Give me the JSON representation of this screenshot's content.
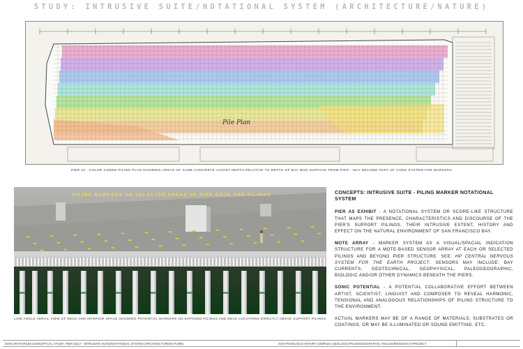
{
  "title": "STUDY: INTRUSIVE SUITE/NOTATIONAL SYSTEM (ARCHITECTURE/NATURE)",
  "plan": {
    "caption": "PIER 15 - COLOR CODED PILING PLAN SHOWING AREAS OF SAME CONCRETE JACKET DEPTH RELATIVE TO DEPTH OF BAY MUD SURFACE FROM PIER - MAY BECOME PART OF CODE SYSTEM FOR MARKERS",
    "label": "Pile Plan",
    "colors": [
      "#e9a0c8",
      "#c9a3e6",
      "#9fc2f0",
      "#9fe2d6",
      "#a8e08e",
      "#e6e487",
      "#f2c591"
    ]
  },
  "photo": {
    "callout": "PILING MARKERS ON SELECTED AREAS OF PIER DECK AND PILINGS",
    "caption": "LOW ANGLE AERIAL VIEW OF DECK AND INTERIOR SPACE SHOWING POTENTIAL MARKERS ON EXPOSED PILINGS AND DECK LOCATIONS DIRECTLY ABOVE SUPPORT PILINGS"
  },
  "concepts": {
    "heading": "CONCEPTS: INTRUSIVE SUITE - PILING MARKER NOTATIONAL SYSTEM",
    "exhibit_term": "PIER AS EXHIBIT",
    "exhibit_text": " - A NOTATIONAL SYSTEM OR SCORE-LIKE STRUCTURE THAT MAPS THE PRESENCE, CHARACTERISTICS AND DISCOURSE OF THE PIER'S SUPPORT PILINGS, THEIR INTRUSIVE EXTENT, HISTORY AND EFFECT ON THE NATURAL ENVIRONMENT OF SAN FRANCISCO BAY.",
    "mote_term": "MOTE ARRAY",
    "mote_text_1": " - MARKER SYSTEM AS A VISUAL/SPACIAL INDICATION STRUCTURE FOR A MOTE-BASED SENSOR ARRAY AT EACH OR SELECTED PILINGS AND BEYOND PIER STRUCTURE.  SEE: ",
    "mote_italic": "HP CENTRAL NERVOUS SYSTEM FOR THE EARTH PROJECT",
    "mote_text_2": ".  SENSORS MAY INCLUDE: BAY CURRENTS, GEOTECHNICAL, GEOPHYSICAL, PALEOGEOGRAPHIC, BIOLOGIC AND/OR OTHER DYNAMICS BENEATH THE PIERS.",
    "sonic_term": "SONIC POTENTIAL",
    "sonic_text": " - A POTENTIAL COLLABORATIVE EFFORT BETWEEN ARTIST, SCIENTIST, LINGUIST AND COMPOSER TO REVEAL HARMONIC, TENSIONAL AND ANALOGOUS RELATIONSHIPS OF PILING STRUCTURE TO THE ENVIRONMENT.",
    "markers_text": "ACTUAL MARKERS MAY BE OF A RANGE OF MATERIALS, SUBSTRATES OR COATINGS, OR MAY BE ILLUMINATED OR SOUND EMITTING, ETC."
  },
  "footer": {
    "left": "EXPLORATORIUM CONCEPTUAL STUDY: PIER 15/17 - INTRUSIVE SUITE/NOTATIONAL SYSTEM (ARCHITECTURE/NATURE)",
    "right": "SAN FRANCISCO WHARF COMPLEX GEOLOGIC/PALEOGEOGRAPHIC ANALOG/RESEARCH PROJECT"
  }
}
